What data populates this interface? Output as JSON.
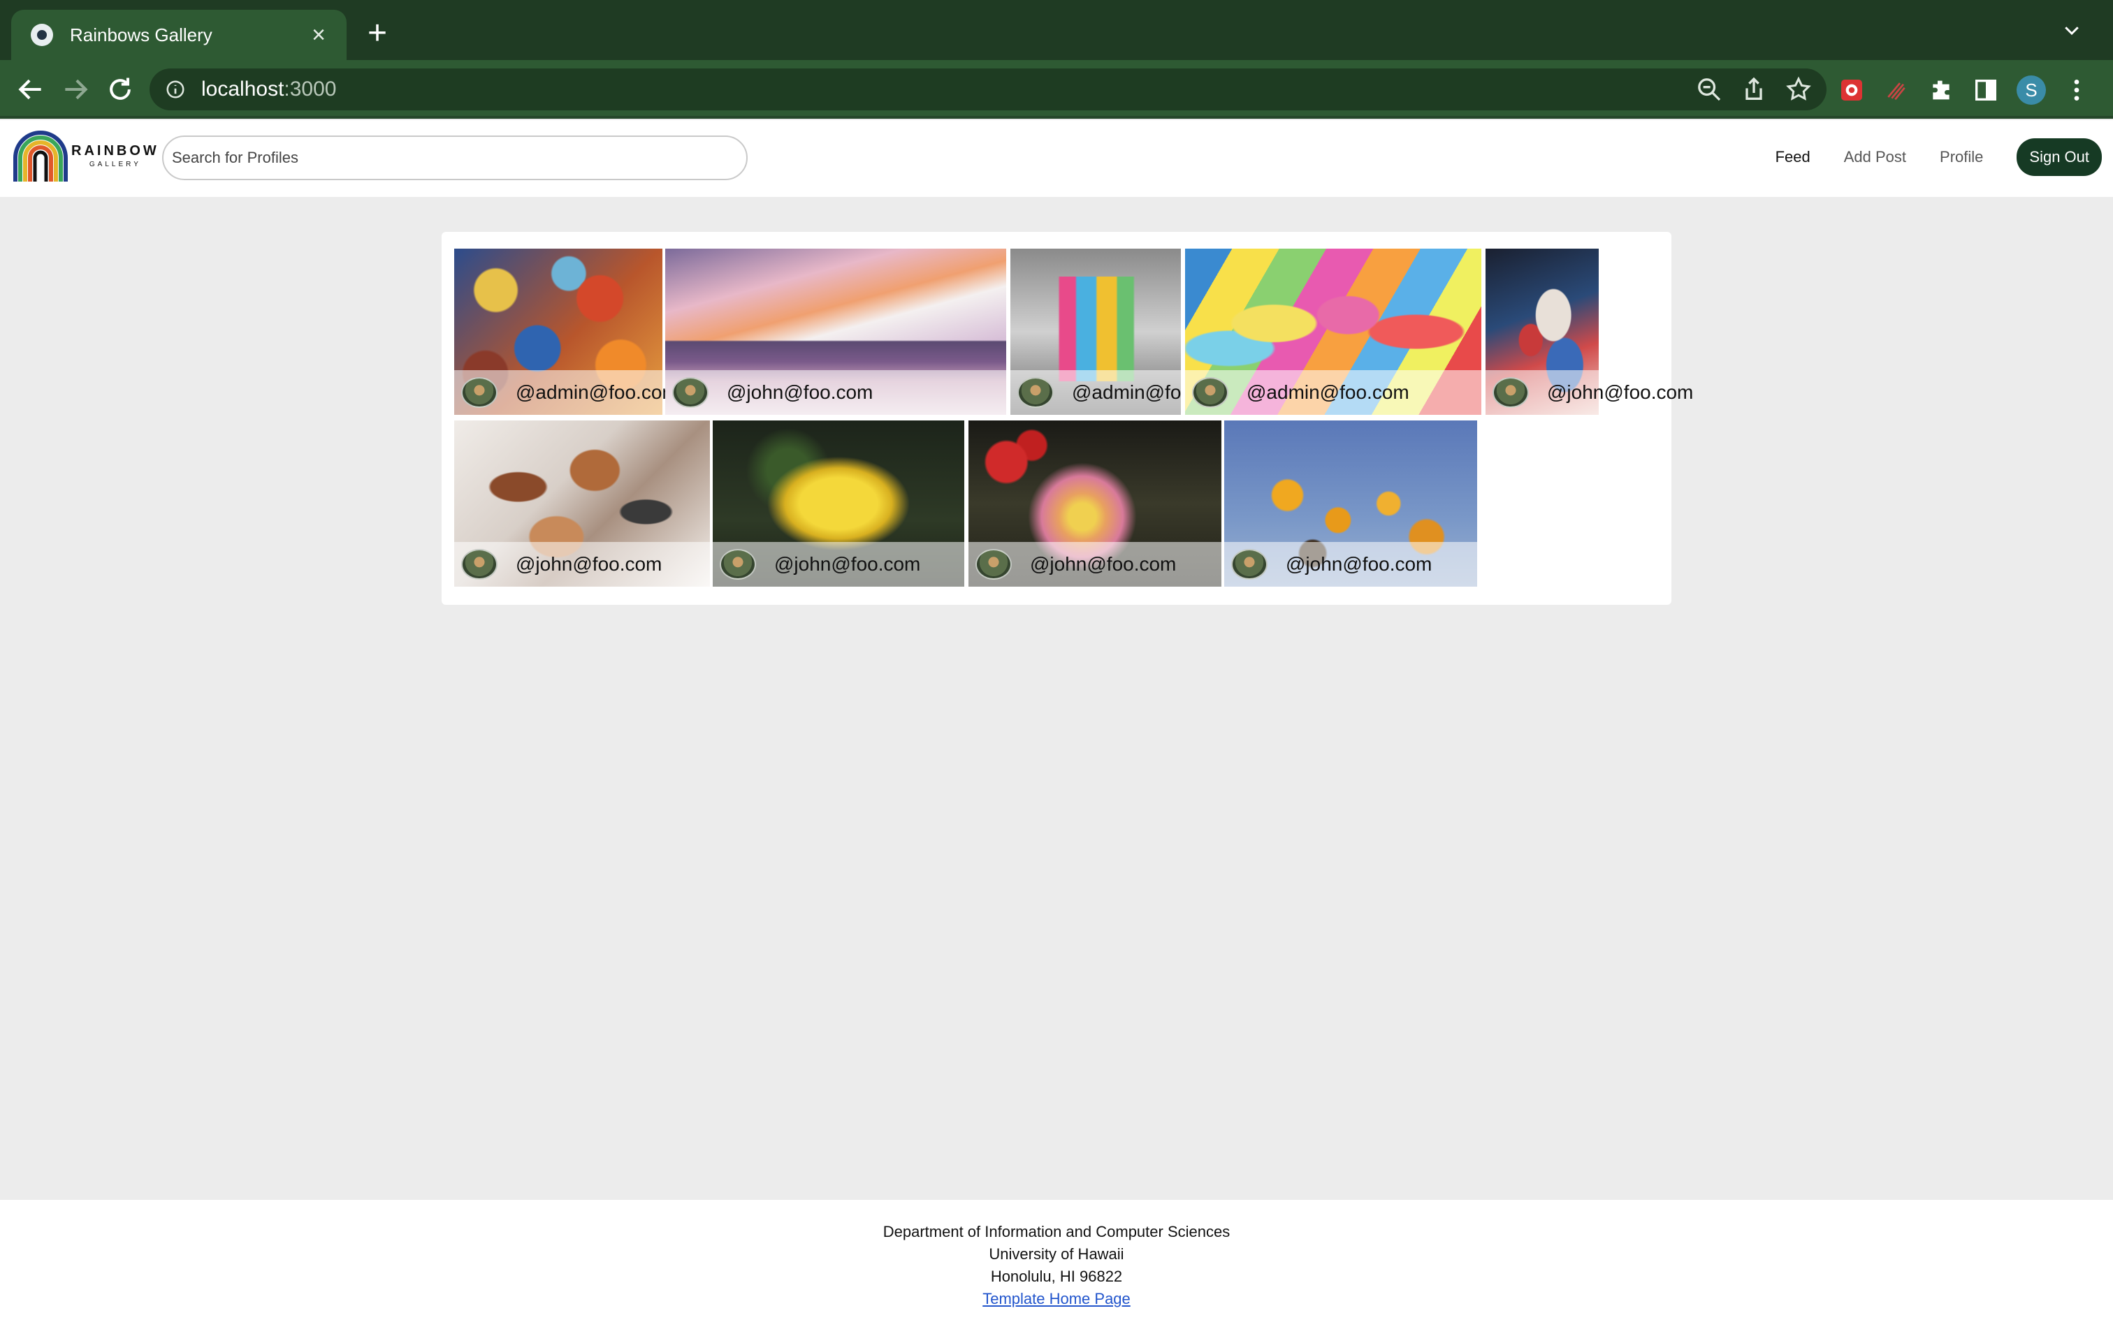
{
  "browser": {
    "tab_title": "Rainbows Gallery",
    "tab_close": "×",
    "new_tab": "+",
    "url_host": "localhost",
    "url_port": ":3000",
    "profile_initial": "S"
  },
  "navbar": {
    "brand_main": "RAINBOW",
    "brand_sub": "GALLERY",
    "search_placeholder": "Search for Profiles",
    "links": [
      "Feed",
      "Add Post",
      "Profile"
    ],
    "sign_out": "Sign Out"
  },
  "gallery": {
    "posts": [
      {
        "handle": "@admin@foo.com",
        "art": "abstract-marbled"
      },
      {
        "handle": "@john@foo.com",
        "art": "city-skyline-painting"
      },
      {
        "handle": "@admin@foo.com",
        "art": "cubist-geometric"
      },
      {
        "handle": "@admin@foo.com",
        "art": "colorful-faces"
      },
      {
        "handle": "@john@foo.com",
        "art": "abstract-figure"
      },
      {
        "handle": "@john@foo.com",
        "art": "abstract-ribbons"
      },
      {
        "handle": "@john@foo.com",
        "art": "yellow-lily"
      },
      {
        "handle": "@john@foo.com",
        "art": "dahlia-flower"
      },
      {
        "handle": "@john@foo.com",
        "art": "black-eyed-susans"
      }
    ]
  },
  "footer": {
    "line1": "Department of Information and Computer Sciences",
    "line2": "University of Hawaii",
    "line3": "Honolulu, HI 96822",
    "link": "Template Home Page"
  }
}
